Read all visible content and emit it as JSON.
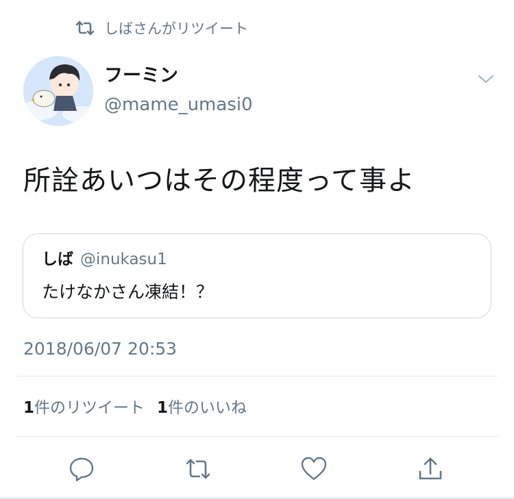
{
  "retweet_banner": {
    "text": "しばさんがリツイート",
    "icon": "retweet-icon"
  },
  "author": {
    "display_name": "フーミン",
    "handle": "@mame_umasi0",
    "avatar": "avatar-image"
  },
  "tweet": {
    "text": "所詮あいつはその程度って事よ",
    "timestamp": "2018/06/07 20:53"
  },
  "quoted_tweet": {
    "display_name": "しば",
    "handle": "@inukasu1",
    "text": "たけなかさん凍結！？"
  },
  "stats": {
    "retweet_count": "1",
    "retweet_label": "件のリツイート",
    "like_count": "1",
    "like_label": "件のいいね"
  },
  "actions": [
    "reply-icon",
    "retweet-icon",
    "like-icon",
    "share-icon"
  ],
  "colors": {
    "text": "#14171a",
    "secondary": "#657786",
    "border": "#ccd6dd",
    "divider": "#e1e8ed"
  }
}
